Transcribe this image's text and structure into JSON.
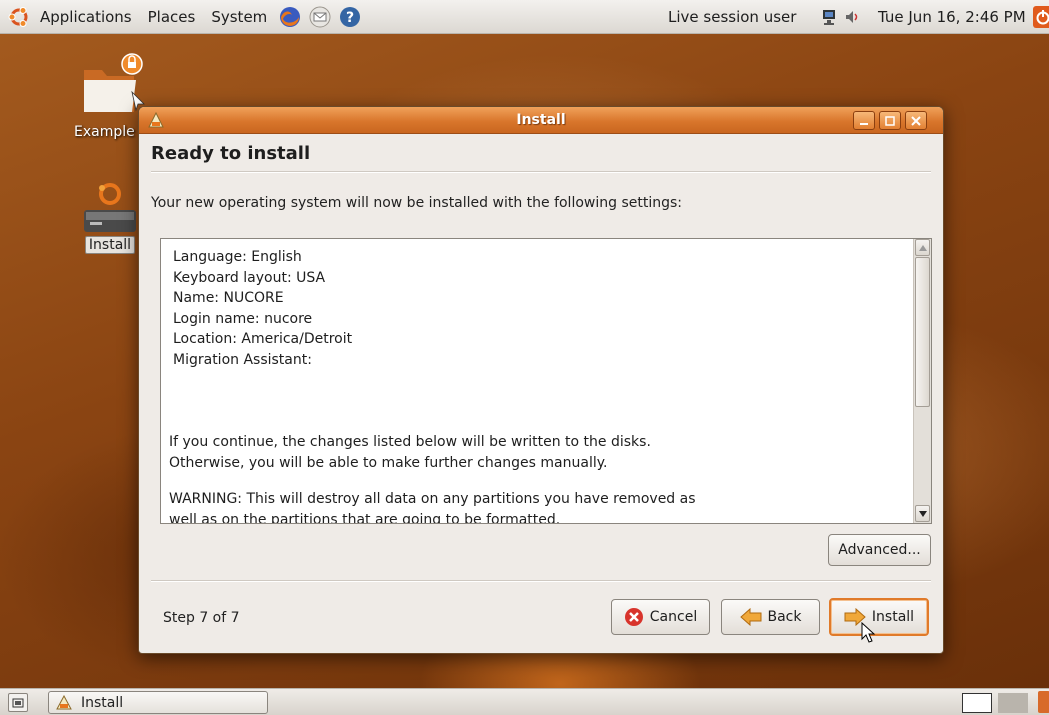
{
  "top_panel": {
    "menus": [
      "Applications",
      "Places",
      "System"
    ],
    "user": "Live session user",
    "clock": "Tue Jun 16,  2:46 PM"
  },
  "desktop": {
    "icons": [
      {
        "label": "Example"
      },
      {
        "label": "Install"
      }
    ]
  },
  "window": {
    "title": "Install",
    "heading": "Ready to install",
    "intro": "Your new operating system will now be installed with the following settings:",
    "settings": [
      "Language: English",
      "Keyboard layout: USA",
      "Name: NUCORE",
      "Login name: nucore",
      "Location: America/Detroit",
      "Migration Assistant:"
    ],
    "notice": [
      "If you continue, the changes listed below will be written to the disks.",
      "Otherwise, you will be able to make further changes manually."
    ],
    "warning": [
      "WARNING: This will destroy all data on any partitions you have removed as",
      "well as on the partitions that are going to be formatted."
    ],
    "advanced_label": "Advanced...",
    "step": "Step 7 of 7",
    "buttons": {
      "cancel": "Cancel",
      "back": "Back",
      "install": "Install"
    }
  },
  "taskbar": {
    "task_label": "Install"
  },
  "colors": {
    "accent": "#e07a2a",
    "titlebar": "#d9762c"
  }
}
